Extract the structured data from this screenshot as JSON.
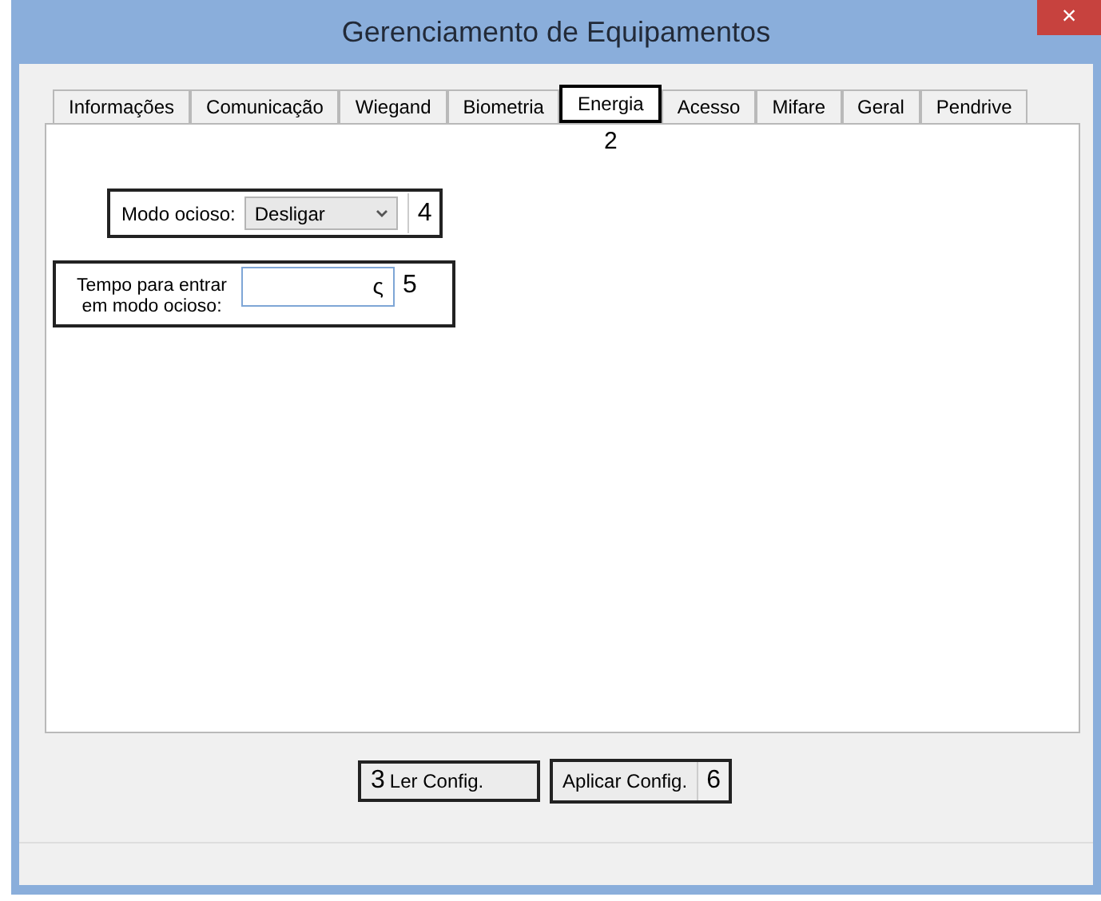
{
  "window": {
    "title": "Gerenciamento de Equipamentos",
    "close": "×"
  },
  "tabs": [
    {
      "label": "Informações",
      "selected": false
    },
    {
      "label": "Comunicação",
      "selected": false
    },
    {
      "label": "Wiegand",
      "selected": false
    },
    {
      "label": "Biometria",
      "selected": false
    },
    {
      "label": "Energia",
      "selected": true,
      "callout": "2"
    },
    {
      "label": "Acesso",
      "selected": false
    },
    {
      "label": "Mifare",
      "selected": false
    },
    {
      "label": "Geral",
      "selected": false
    },
    {
      "label": "Pendrive",
      "selected": false
    }
  ],
  "idle_mode": {
    "label": "Modo ocioso:",
    "value": "Desligar",
    "callout": "4"
  },
  "idle_time": {
    "label": "Tempo para entrar em modo ocioso:",
    "value": "ς",
    "callout": "5"
  },
  "buttons": [
    {
      "label": "Ler Config.",
      "callout": "3",
      "kind": "lead"
    },
    {
      "label": "Aplicar Config.",
      "callout": "6",
      "kind": "trail"
    }
  ]
}
